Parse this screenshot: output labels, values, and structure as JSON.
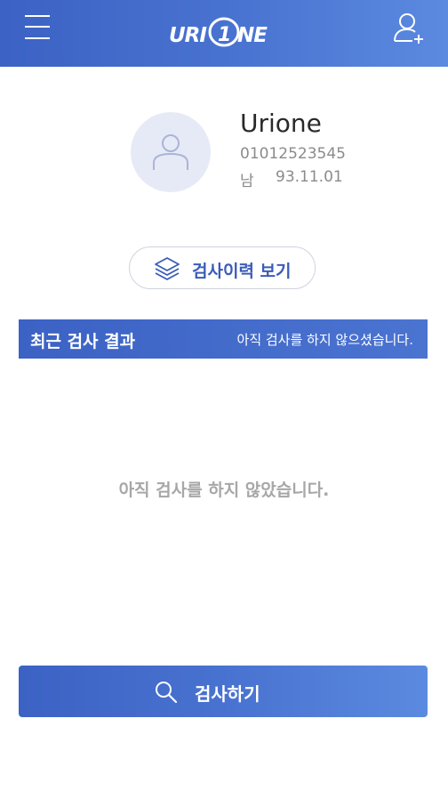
{
  "header": {
    "logo_text": "URIONE",
    "menu_icon": "hamburger-menu-icon",
    "add_user_icon": "add-user-icon"
  },
  "profile": {
    "name": "Urione",
    "phone": "01012523545",
    "gender": "남",
    "birth": "93.11.01",
    "avatar_icon": "user-icon"
  },
  "history_button": {
    "label": "검사이력 보기",
    "icon": "layers-icon"
  },
  "recent_result": {
    "title": "최근 검사 결과",
    "status": "아직 검사를 하지 않으셨습니다."
  },
  "empty_message": "아직 검사를 하지 않았습니다.",
  "test_button": {
    "label": "검사하기",
    "icon": "search-icon"
  },
  "colors": {
    "primary": "#3b62c4",
    "primary_light": "#5b8ae0",
    "avatar_bg": "#e6eaf6",
    "muted_text": "#8b8b8b"
  }
}
